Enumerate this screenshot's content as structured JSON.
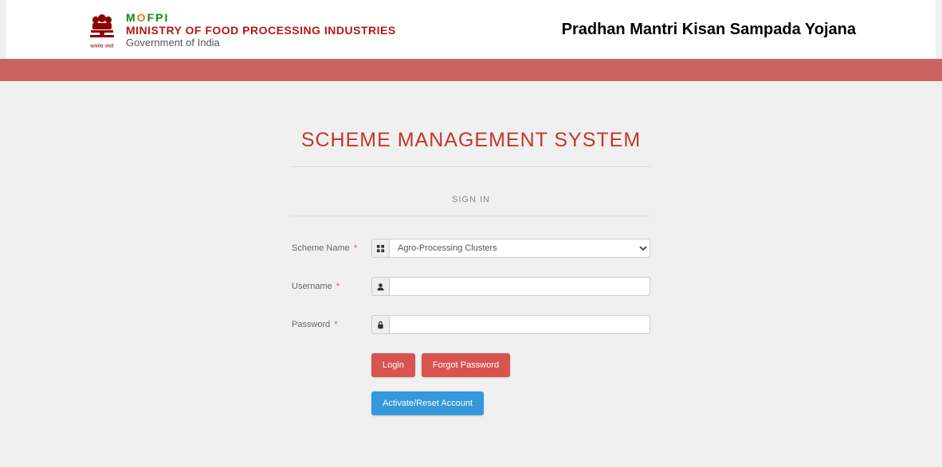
{
  "header": {
    "emblem_caption": "सत्यमेव जयते",
    "mofpi": {
      "m1": "M",
      "o": "O",
      "rest": "FPI"
    },
    "ministry_full": "MINISTRY OF FOOD PROCESSING INDUSTRIES",
    "govt_line": "Government of India",
    "right_title": "Pradhan Mantri Kisan Sampada Yojana"
  },
  "main": {
    "system_heading": "SCHEME MANAGEMENT SYSTEM",
    "signin_label": "SIGN IN"
  },
  "form": {
    "scheme_label": "Scheme Name",
    "scheme_value": "Agro-Processing Clusters",
    "username_label": "Username",
    "username_value": "",
    "password_label": "Password",
    "password_value": ""
  },
  "buttons": {
    "login": "Login",
    "forgot": "Forgot Password",
    "activate": "Activate/Reset Account"
  }
}
